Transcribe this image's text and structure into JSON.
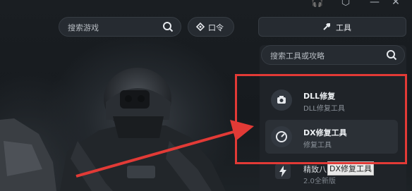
{
  "header": {
    "search": {
      "placeholder": "搜索游戏",
      "icon": "search-icon"
    },
    "password_button": {
      "label": "口令",
      "icon": "tag-icon"
    },
    "tools_button": {
      "label": "工具",
      "icon": "tools-icon"
    }
  },
  "tool_panel": {
    "search": {
      "placeholder": "搜索工具或攻略",
      "icon": "search-icon"
    },
    "items": [
      {
        "name": "DLL修复",
        "desc": "DLL修复工具",
        "icon": "camera-icon"
      },
      {
        "name": "DX修复工具",
        "desc": "修复工具",
        "icon": "dial-icon"
      },
      {
        "name": "精致八",
        "desc": "2.0全新版",
        "icon": "bolt-icon"
      }
    ],
    "tooltip": "DX修复工具"
  },
  "colors": {
    "highlight": "#e23a36",
    "panel_bg": "#1f2328",
    "accent": "#262b31"
  }
}
